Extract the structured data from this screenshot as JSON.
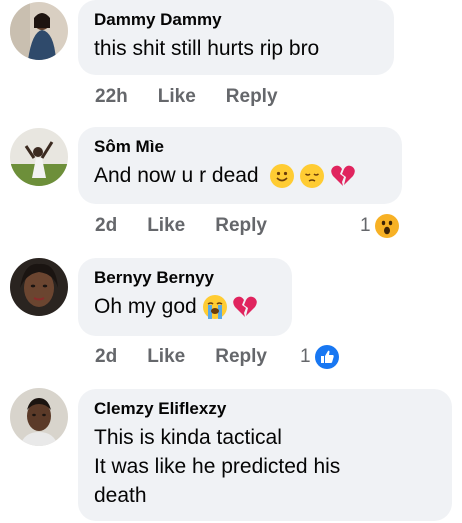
{
  "comments": [
    {
      "author": "Dammy Dammy",
      "text": "this shit still hurts rip bro",
      "time": "22h",
      "like_label": "Like",
      "reply_label": "Reply"
    },
    {
      "author": "Sôm Mìe",
      "text": "And now u r dead",
      "time": "2d",
      "like_label": "Like",
      "reply_label": "Reply",
      "reaction_count": "1",
      "reaction_icon": "wow-reaction-icon"
    },
    {
      "author": "Bernyy Bernyy",
      "text": "Oh my god",
      "time": "2d",
      "like_label": "Like",
      "reply_label": "Reply",
      "reaction_count": "1",
      "reaction_icon": "like-reaction-icon"
    },
    {
      "author": "Clemzy Eliflexzy",
      "text_lines": [
        "This is kinda tactical",
        "It was like he predicted his",
        "death"
      ]
    }
  ],
  "colors": {
    "bubble": "#f0f2f5",
    "meta_text": "#65676b",
    "like_blue": "#1877f2",
    "heart_red": "#e0245e"
  }
}
